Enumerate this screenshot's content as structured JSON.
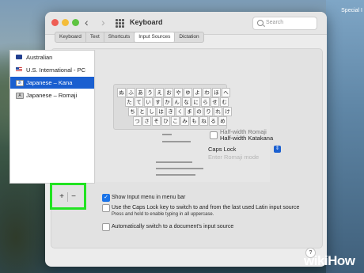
{
  "desktop": {
    "top_right_text": "Special I"
  },
  "window": {
    "title": "Keyboard"
  },
  "search": {
    "placeholder": "Search"
  },
  "tabs": [
    {
      "label": "Keyboard",
      "active": false
    },
    {
      "label": "Text",
      "active": false
    },
    {
      "label": "Shortcuts",
      "active": false
    },
    {
      "label": "Input Sources",
      "active": true
    },
    {
      "label": "Dictation",
      "active": false
    }
  ],
  "sources": [
    {
      "label": "Australian",
      "icon": "au-flag-icon",
      "selected": false
    },
    {
      "label": "U.S. International - PC",
      "icon": "us-flag-icon",
      "selected": false
    },
    {
      "label": "Japanese – Kana",
      "icon": "japanese-kana-icon",
      "selected": true
    },
    {
      "label": "Japanese – Romaji",
      "icon": "japanese-romaji-icon",
      "selected": false
    }
  ],
  "keyboard": {
    "rows": [
      [
        "ぬ",
        "ふ",
        "あ",
        "う",
        "え",
        "お",
        "や",
        "ゆ",
        "よ",
        "わ",
        "ほ",
        "へ"
      ],
      [
        "た",
        "て",
        "い",
        "す",
        "か",
        "ん",
        "な",
        "に",
        "ら",
        "せ",
        "む"
      ],
      [
        "ち",
        "と",
        "し",
        "は",
        "き",
        "く",
        "ま",
        "の",
        "り",
        "れ",
        "け"
      ],
      [
        "つ",
        "さ",
        "そ",
        "ひ",
        "こ",
        "み",
        "も",
        "ね",
        "る",
        "め"
      ]
    ]
  },
  "options": {
    "halfwidth_romaji": "Half-width Romaji",
    "halfwidth_katakana": "Half-width Katakana",
    "caps_lock": "Caps Lock",
    "romaji_mode": "Enter Romaji mode",
    "show_menu": "Show Input menu in menu bar",
    "use_caps": "Use the Caps Lock key to switch to and from the last used Latin input source",
    "press_hold": "Press and hold to enable typing in all uppercase.",
    "auto_switch": "Automatically switch to a document's input source"
  },
  "controls": {
    "add": "+",
    "remove": "−",
    "help": "?"
  },
  "watermark": {
    "text": "wikiHow"
  },
  "colors": {
    "selection": "#1a5fd0",
    "highlight_box": "#22e322"
  }
}
